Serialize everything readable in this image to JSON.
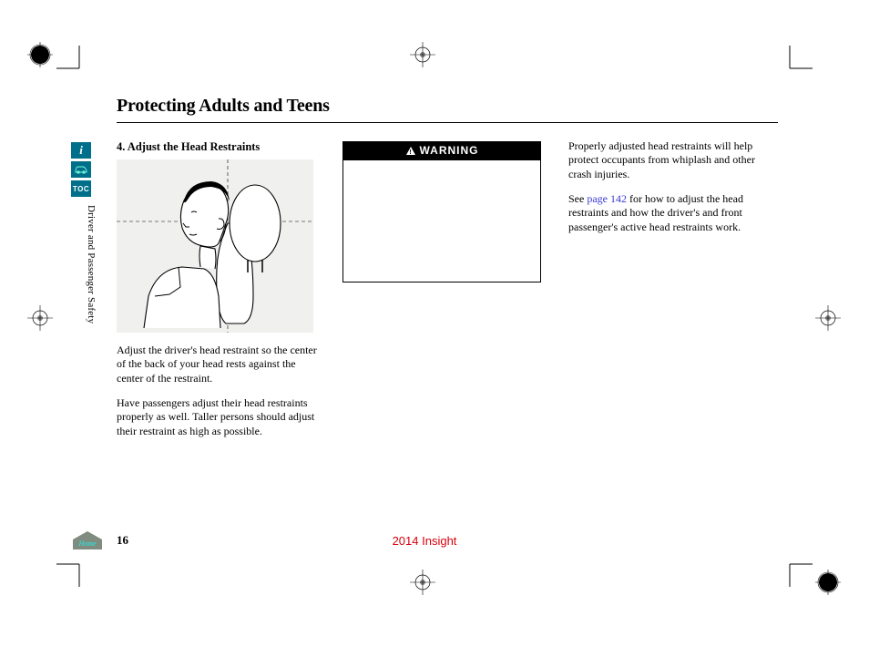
{
  "sidebar": {
    "info_label": "i",
    "toc_label": "TOC"
  },
  "vertical_section": "Driver and Passenger Safety",
  "title": "Protecting Adults and Teens",
  "col1": {
    "step_heading": "4. Adjust the Head Restraints",
    "para1": "Adjust the driver's head restraint so the center of the back of your head rests against the center of the restraint.",
    "para2": "Have passengers adjust their head restraints properly as well. Taller persons should adjust their restraint as high as possible."
  },
  "col2": {
    "warning_label": "WARNING"
  },
  "col3": {
    "para1": "Properly adjusted head restraints will help protect occupants from whiplash and other crash injuries.",
    "para2_a": "See ",
    "page_link": "page 142",
    "para2_b": " for how to adjust the head restraints and how the driver's and front passenger's active head restraints work."
  },
  "footer": {
    "home_label": "Home",
    "page_number": "16",
    "doc_label": "2014 Insight"
  }
}
